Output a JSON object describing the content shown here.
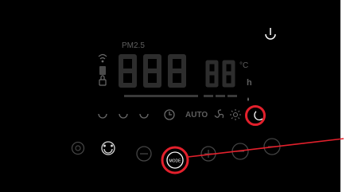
{
  "display": {
    "pm_label": "PM2.5",
    "main_digits": "888",
    "small_digits": "88",
    "unit_celsius": "°C",
    "unit_hours": "h",
    "auto_label": "AUTO"
  },
  "buttons": {
    "mode_label": "MODE"
  },
  "icons": {
    "wifi": "wifi-icon",
    "child_lock": "child-lock-icon",
    "lock": "lock-icon",
    "fan_speed": "fan-speed-icon",
    "timer": "timer-icon",
    "fan": "fan-icon",
    "sun": "uv-light-icon",
    "sleep": "moon-icon",
    "power": "power-icon"
  },
  "colors": {
    "panel": "#000000",
    "dim_segment": "#2d2d2d",
    "icon_gray": "#6a6a6a",
    "bright": "#ffffff",
    "highlight": "#e3202c"
  }
}
